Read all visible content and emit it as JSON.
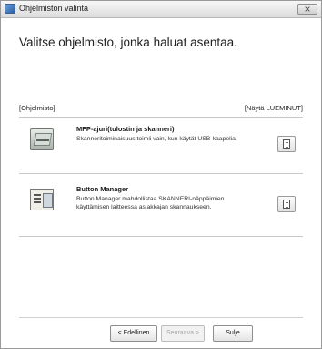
{
  "window": {
    "title": "Ohjelmiston valinta",
    "close_label": ""
  },
  "heading": "Valitse ohjelmisto, jonka haluat asentaa.",
  "list": {
    "header_left": "[Ohjelmisto]",
    "header_right": "[Näytä LUEMINUT]",
    "items": [
      {
        "title": "MFP-ajuri(tulostin ja skanneri)",
        "description": "Skanneritoiminaisuus toimii vain, kun käytät USB-kaapelia.",
        "icon": "scanner-icon"
      },
      {
        "title": "Button Manager",
        "description": "Button Manager mahdollistaa SKANNERI-näppäimien käyttämisen laitteessa asiakkajan skannaukseen.",
        "icon": "button-manager-icon"
      }
    ]
  },
  "footer": {
    "back_label": "< Edellinen",
    "next_label": "Seuraava >",
    "close_label": "Sulje"
  },
  "colors": {
    "titlebar": "#dcdcdc",
    "text": "#1a1a1a",
    "disabled_text": "#a5a5a5",
    "rule": "#c9c9c9"
  }
}
